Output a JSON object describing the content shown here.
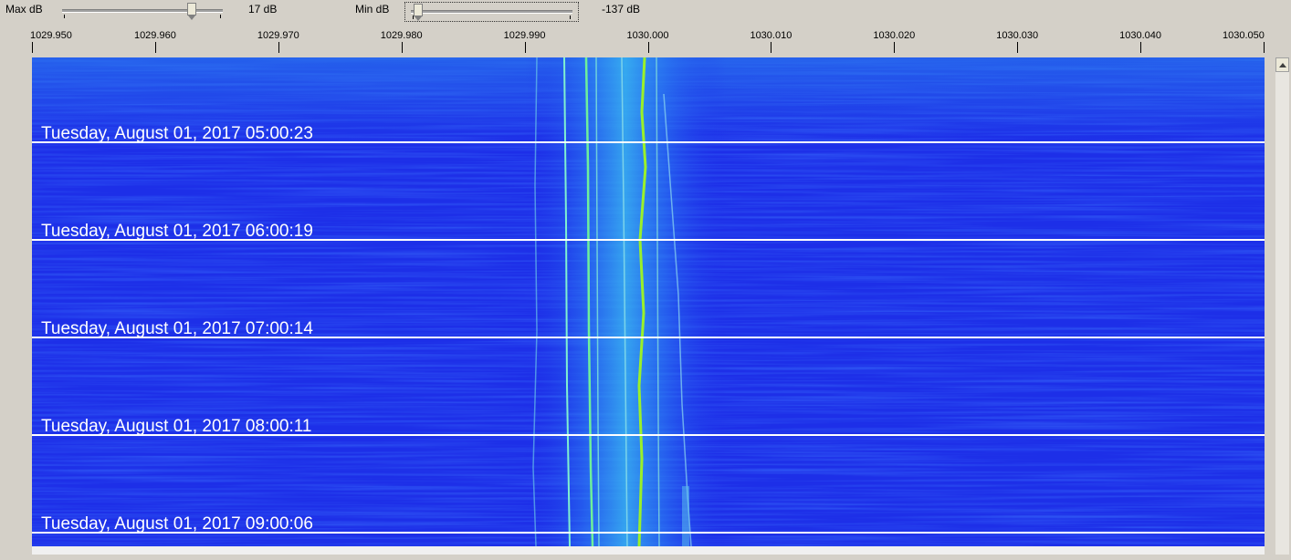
{
  "controls": {
    "max_db": {
      "label": "Max dB",
      "value_text": "17 dB",
      "value": 17
    },
    "min_db": {
      "label": "Min dB",
      "value_text": "-137 dB",
      "value": -137
    }
  },
  "frequency_axis": {
    "ticks": [
      "1029.950",
      "1029.960",
      "1029.970",
      "1029.980",
      "1029.990",
      "1030.000",
      "1030.010",
      "1030.020",
      "1030.030",
      "1030.040",
      "1030.050"
    ]
  },
  "waterfall": {
    "background_color": "#1d2fe8",
    "timestamps": [
      "Tuesday, August 01, 2017 05:00:23",
      "Tuesday, August 01, 2017 06:00:19",
      "Tuesday, August 01, 2017 07:00:14",
      "Tuesday, August 01, 2017 08:00:11",
      "Tuesday, August 01, 2017 09:00:06"
    ]
  },
  "scrollbar": {
    "up_icon": "scroll-up-arrow-icon"
  }
}
